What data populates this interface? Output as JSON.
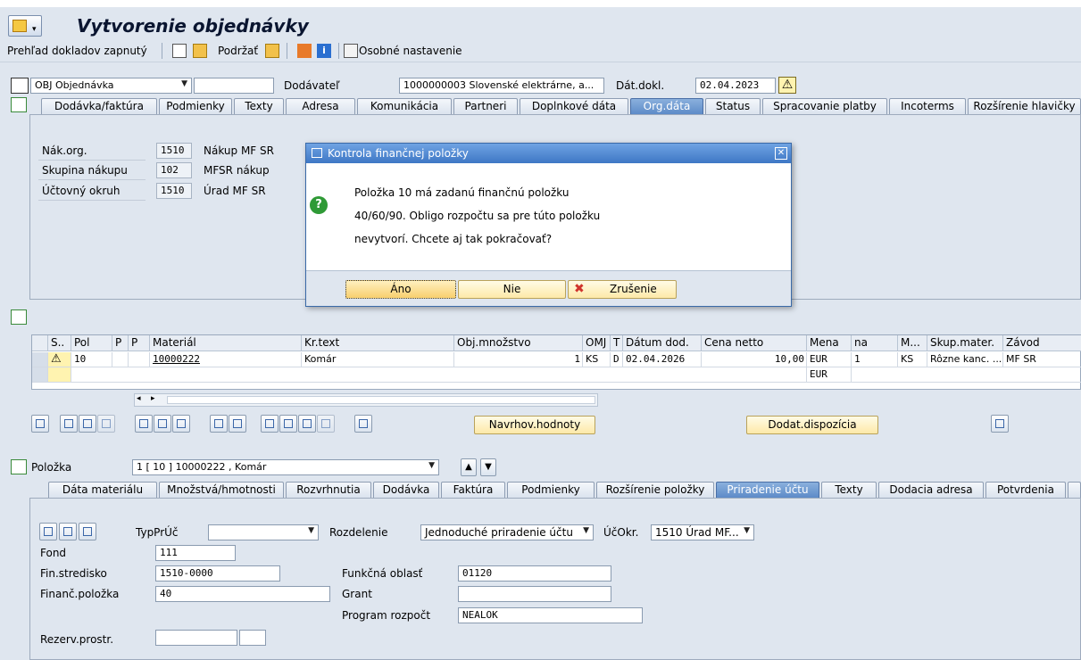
{
  "title": "Vytvorenie objednávky",
  "toolbar": {
    "prehlad": "Prehľad dokladov zapnutý",
    "podrzat": "Podržať",
    "osobne": "Osobné nastavenie"
  },
  "header": {
    "doc_type": "OBJ Objednávka",
    "doc_number": "",
    "vendor_label": "Dodávateľ",
    "vendor_value": "1000000003 Slovenské elektrárne, a...",
    "date_label": "Dát.dokl.",
    "date_value": "02.04.2023"
  },
  "header_tabs": [
    "Dodávka/faktúra",
    "Podmienky",
    "Texty",
    "Adresa",
    "Komunikácia",
    "Partneri",
    "Doplnkové dáta",
    "Org.dáta",
    "Status",
    "Spracovanie platby",
    "Incoterms",
    "Rozšírenie hlavičky"
  ],
  "orgdata": {
    "nakorg_label": "Nák.org.",
    "nakorg_code": "1510",
    "nakorg_text": "Nákup MF SR",
    "skup_label": "Skupina nákupu",
    "skup_code": "102",
    "skup_text": "MFSR nákup",
    "uo_label": "Účtovný okruh",
    "uo_code": "1510",
    "uo_text": "Úrad MF SR"
  },
  "dialog": {
    "title": "Kontrola finančnej položky",
    "line1": "Položka 10 má zadanú finančnú položku",
    "line2": "40/60/90. Obligo rozpočtu sa pre túto položku",
    "line3": "nevytvorí. Chcete aj tak pokračovať?",
    "yes": "Áno",
    "no": "Nie",
    "cancel": "Zrušenie"
  },
  "items_table": {
    "headers": [
      "S..",
      "Pol",
      "P",
      "P",
      "Materiál",
      "Kr.text",
      "Obj.množstvo",
      "OMJ",
      "T",
      "Dátum dod.",
      "Cena netto",
      "Mena",
      "na",
      "M...",
      "Skup.mater.",
      "Závod"
    ],
    "row1": {
      "pol": "10",
      "material": "10000222",
      "krtext": "Komár",
      "qty": "1",
      "omj": "KS",
      "t": "D",
      "date": "02.04.2026",
      "price": "10,00",
      "mena": "EUR",
      "na": "1",
      "m": "KS",
      "skup": "Rôzne kanc. ...",
      "zavod": "MF SR"
    },
    "row2": {
      "mena": "EUR"
    }
  },
  "item_buttons": {
    "navrh": "Navrhov.hodnoty",
    "dodat": "Dodat.dispozícia"
  },
  "item_detail": {
    "label": "Položka",
    "select": "1 [ 10 ] 10000222 , Komár"
  },
  "item_tabs": [
    "Dáta materiálu",
    "Množstvá/hmotnosti",
    "Rozvrhnutia",
    "Dodávka",
    "Faktúra",
    "Podmienky",
    "Rozšírenie položky",
    "Priradenie účtu",
    "Texty",
    "Dodacia adresa",
    "Potvrdenia"
  ],
  "account": {
    "typpru_label": "TypPrÚč",
    "rozdelenie_label": "Rozdelenie",
    "rozdelenie_value": "Jednoduché priradenie účtu",
    "ucokr_label": "ÚčOkr.",
    "ucokr_value": "1510 Úrad MF...",
    "fond_label": "Fond",
    "fond_value": "111",
    "finstr_label": "Fin.stredisko",
    "finstr_value": "1510-0000",
    "funk_label": "Funkčná oblasť",
    "funk_value": "01120",
    "finpol_label": "Finanč.položka",
    "finpol_value": "40",
    "grant_label": "Grant",
    "program_label": "Program rozpočt",
    "program_value": "NEALOK",
    "rezerv_label": "Rezerv.prostr."
  }
}
